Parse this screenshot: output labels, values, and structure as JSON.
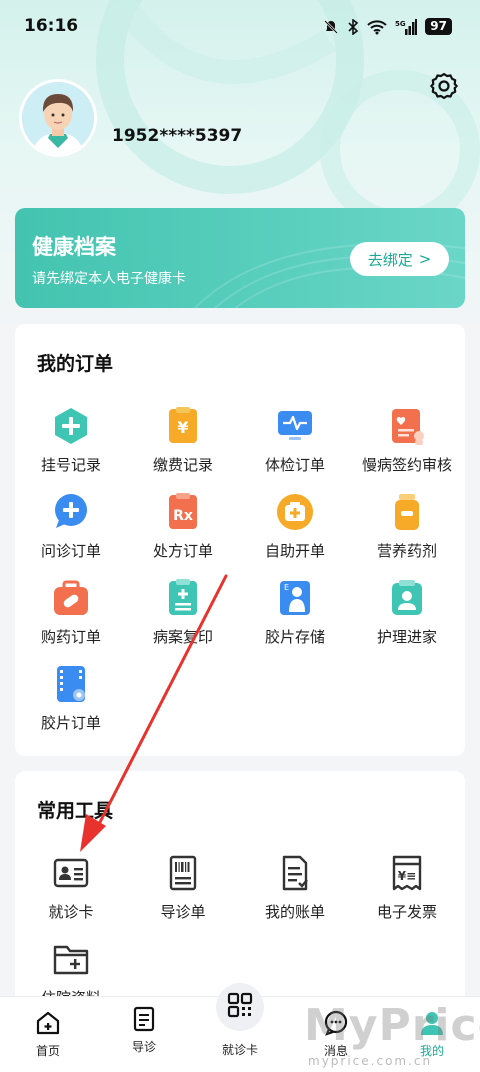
{
  "status_bar": {
    "time": "16:16",
    "battery": "97",
    "network": "5G"
  },
  "profile": {
    "phone": "1952****5397"
  },
  "health_card": {
    "title": "健康档案",
    "subtitle": "请先绑定本人电子健康卡",
    "bind_label": "去绑定",
    "chevron": ">"
  },
  "orders": {
    "title": "我的订单",
    "items": [
      {
        "label": "挂号记录",
        "icon": "plus-icon"
      },
      {
        "label": "缴费记录",
        "icon": "yen-bill-icon"
      },
      {
        "label": "体检订单",
        "icon": "monitor-pulse-icon"
      },
      {
        "label": "慢病签约审核",
        "icon": "heart-doc-icon"
      },
      {
        "label": "问诊订单",
        "icon": "chat-plus-icon"
      },
      {
        "label": "处方订单",
        "icon": "rx-icon"
      },
      {
        "label": "自助开单",
        "icon": "medical-kit-icon"
      },
      {
        "label": "营养药剂",
        "icon": "bottle-icon"
      },
      {
        "label": "购药订单",
        "icon": "pill-box-icon"
      },
      {
        "label": "病案复印",
        "icon": "clipboard-icon"
      },
      {
        "label": "胶片存储",
        "icon": "xray-icon"
      },
      {
        "label": "护理进家",
        "icon": "nurse-icon"
      },
      {
        "label": "胶片订单",
        "icon": "film-icon"
      }
    ]
  },
  "tools": {
    "title": "常用工具",
    "items": [
      {
        "label": "就诊卡",
        "icon": "id-card-icon"
      },
      {
        "label": "导诊单",
        "icon": "barcode-doc-icon"
      },
      {
        "label": "我的账单",
        "icon": "bill-icon"
      },
      {
        "label": "电子发票",
        "icon": "invoice-icon"
      },
      {
        "label": "住院资料",
        "icon": "folder-plus-icon"
      }
    ]
  },
  "bottom_nav": {
    "items": [
      {
        "label": "首页",
        "icon": "home-icon"
      },
      {
        "label": "导诊",
        "icon": "guide-icon"
      },
      {
        "label": "就诊卡",
        "icon": "qr-icon"
      },
      {
        "label": "消息",
        "icon": "message-icon"
      },
      {
        "label": "我的",
        "icon": "person-icon"
      }
    ],
    "active": "我的"
  },
  "watermark": {
    "brand": "MyPrice",
    "url": "myprice.com.cn"
  },
  "colors": {
    "accent": "#1aa995",
    "health_card": "#43c4b0",
    "arrow": "#e8322d"
  }
}
